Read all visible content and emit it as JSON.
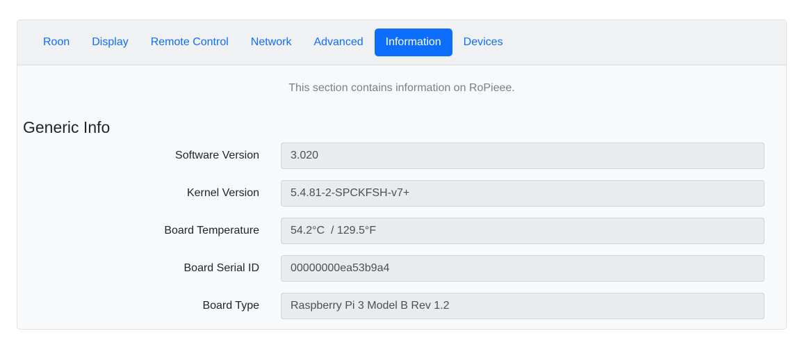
{
  "tabs": [
    {
      "label": "Roon",
      "active": false
    },
    {
      "label": "Display",
      "active": false
    },
    {
      "label": "Remote Control",
      "active": false
    },
    {
      "label": "Network",
      "active": false
    },
    {
      "label": "Advanced",
      "active": false
    },
    {
      "label": "Information",
      "active": true
    },
    {
      "label": "Devices",
      "active": false
    }
  ],
  "intro_text": "This section contains information on RoPieee.",
  "section_title": "Generic Info",
  "fields": [
    {
      "label": "Software Version",
      "value": "3.020"
    },
    {
      "label": "Kernel Version",
      "value": "5.4.81-2-SPCKFSH-v7+"
    },
    {
      "label": "Board Temperature",
      "value": "54.2°C  / 129.5°F"
    },
    {
      "label": "Board Serial ID",
      "value": "00000000ea53b9a4"
    },
    {
      "label": "Board Type",
      "value": "Raspberry Pi 3 Model B Rev 1.2"
    }
  ],
  "colors": {
    "accent": "#0d6efd",
    "card_background": "#f8f9fa",
    "header_background": "#f0f1f2",
    "readonly_field": "#e9ecef"
  }
}
